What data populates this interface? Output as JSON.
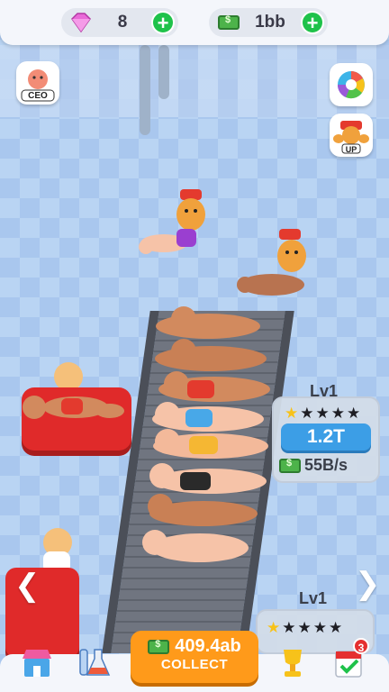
{
  "currency": {
    "gems": "8",
    "cash": "1bb"
  },
  "side_buttons": {
    "ceo_label": "CEO",
    "upgrade_label": "UP"
  },
  "stations": [
    {
      "level": "Lv1",
      "stars_filled": 1,
      "stars_total": 5,
      "price": "1.2T",
      "income": "55B/s"
    },
    {
      "level": "Lv1",
      "stars_filled": 1,
      "stars_total": 5
    }
  ],
  "collect": {
    "amount": "409.4ab",
    "label": "COLLECT"
  },
  "notifications": {
    "tasks_badge": "3"
  },
  "colors": {
    "accent_orange": "#ff9a1a",
    "price_blue": "#3c9ee6",
    "plus_green": "#1fc24a",
    "badge_red": "#e53030"
  },
  "icons": [
    "gem-icon",
    "cash-icon",
    "ceo-icon",
    "color-wheel-icon",
    "upgrade-icon",
    "shop-icon",
    "lab-icon",
    "trophy-icon",
    "tasks-icon",
    "arrow-right-icon",
    "arrow-left-icon"
  ]
}
